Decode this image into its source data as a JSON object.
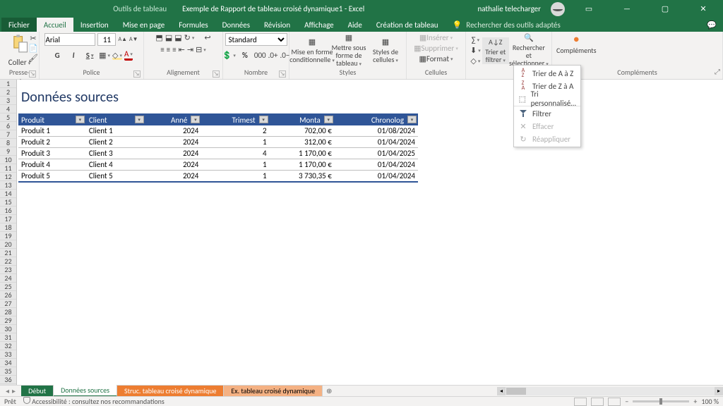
{
  "titlebar": {
    "tabtools": "Outils de tableau",
    "doc": "Exemple de Rapport de tableau croisé dynamique1 - Excel",
    "user": "nathalie telecharger"
  },
  "menu": {
    "items": [
      "Fichier",
      "Accueil",
      "Insertion",
      "Mise en page",
      "Formules",
      "Données",
      "Révision",
      "Affichage",
      "Aide",
      "Création de tableau"
    ],
    "active": 1,
    "tell": "Rechercher des outils adaptés"
  },
  "ribbon": {
    "clipboard": {
      "paste": "Coller",
      "label": "Presse-papiers"
    },
    "font": {
      "name": "Arial",
      "size": "11",
      "bold": "G",
      "italic": "I",
      "underline": "S",
      "label": "Police"
    },
    "alignment": {
      "label": "Alignement"
    },
    "number": {
      "format": "Standard",
      "label": "Nombre"
    },
    "styles": {
      "cond": "Mise en forme conditionnelle",
      "table": "Mettre sous forme de tableau",
      "cell": "Styles de cellules",
      "label": "Styles"
    },
    "cells": {
      "insert": "Insérer",
      "delete": "Supprimer",
      "format": "Format",
      "label": "Cellules"
    },
    "editing": {
      "sort": "Trier et filtrer",
      "find": "Rechercher et sélectionner"
    },
    "addins": {
      "title": "Compléments",
      "label": "Compléments"
    }
  },
  "sortmenu": {
    "az": "Trier de A à Z",
    "za": "Trier de Z à A",
    "custom": "Tri personnalisé…",
    "filter": "Filtrer",
    "clear": "Effacer",
    "reapply": "Réappliquer"
  },
  "sheet": {
    "title": "Données sources",
    "headers": [
      "Produit",
      "Client",
      "Anné",
      "Trimest",
      "Monta",
      "Chronolog"
    ],
    "rows": [
      [
        "Produit 1",
        "Client 1",
        "2024",
        "2",
        "702,00 €",
        "01/08/2024"
      ],
      [
        "Produit 2",
        "Client 2",
        "2024",
        "1",
        "312,00 €",
        "01/04/2024"
      ],
      [
        "Produit 3",
        "Client 3",
        "2024",
        "4",
        "1 170,00 €",
        "01/04/2025"
      ],
      [
        "Produit 4",
        "Client 4",
        "2024",
        "1",
        "1 170,00 €",
        "01/04/2024"
      ],
      [
        "Produit 5",
        "Client 5",
        "2024",
        "1",
        "3 730,35 €",
        "01/04/2024"
      ]
    ]
  },
  "tabs": [
    "Début",
    "Données sources",
    "Struc. tableau croisé dynamique",
    "Ex. tableau croisé dynamique"
  ],
  "status": {
    "ready": "Prêt",
    "access": "Accessibilité : consultez nos recommandations",
    "zoom": "100 %"
  }
}
